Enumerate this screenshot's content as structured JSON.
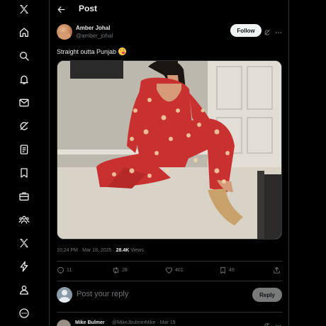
{
  "nav": {
    "items": [
      {
        "icon": "x-logo-icon"
      },
      {
        "icon": "home-icon"
      },
      {
        "icon": "search-icon"
      },
      {
        "icon": "notifications-bell-icon"
      },
      {
        "icon": "messages-envelope-icon"
      },
      {
        "icon": "grok-icon"
      },
      {
        "icon": "lists-icon"
      },
      {
        "icon": "bookmarks-icon"
      },
      {
        "icon": "jobs-briefcase-icon"
      },
      {
        "icon": "communities-icon"
      },
      {
        "icon": "premium-x-icon"
      },
      {
        "icon": "verified-orgs-lightning-icon"
      },
      {
        "icon": "profile-icon"
      },
      {
        "icon": "more-circle-icon"
      }
    ]
  },
  "header": {
    "title": "Post"
  },
  "post": {
    "author_name": "Amber Johal",
    "author_handle": "@amber_johal",
    "follow_label": "Follow",
    "text": "Straight outta Punjab",
    "timestamp": "10:24 PM · Mar 18, 2025 · ",
    "views_count": "28.4K",
    "views_label": " Views",
    "stats": {
      "replies": "11",
      "reposts": "28",
      "likes": "401",
      "bookmarks": "46"
    }
  },
  "reply_box": {
    "placeholder": "Post your reply",
    "button_label": "Reply"
  },
  "next_reply": {
    "author_name": "Mike Bulmer",
    "meta": "@MikeJbulmerMike · Mar 19"
  },
  "colors": {
    "background": "#000000",
    "text_primary": "#e7e9ea",
    "text_secondary": "#71767b",
    "border": "#2f3336",
    "follow_button": "#eff3f4",
    "reply_button_disabled": "#787a7a"
  }
}
